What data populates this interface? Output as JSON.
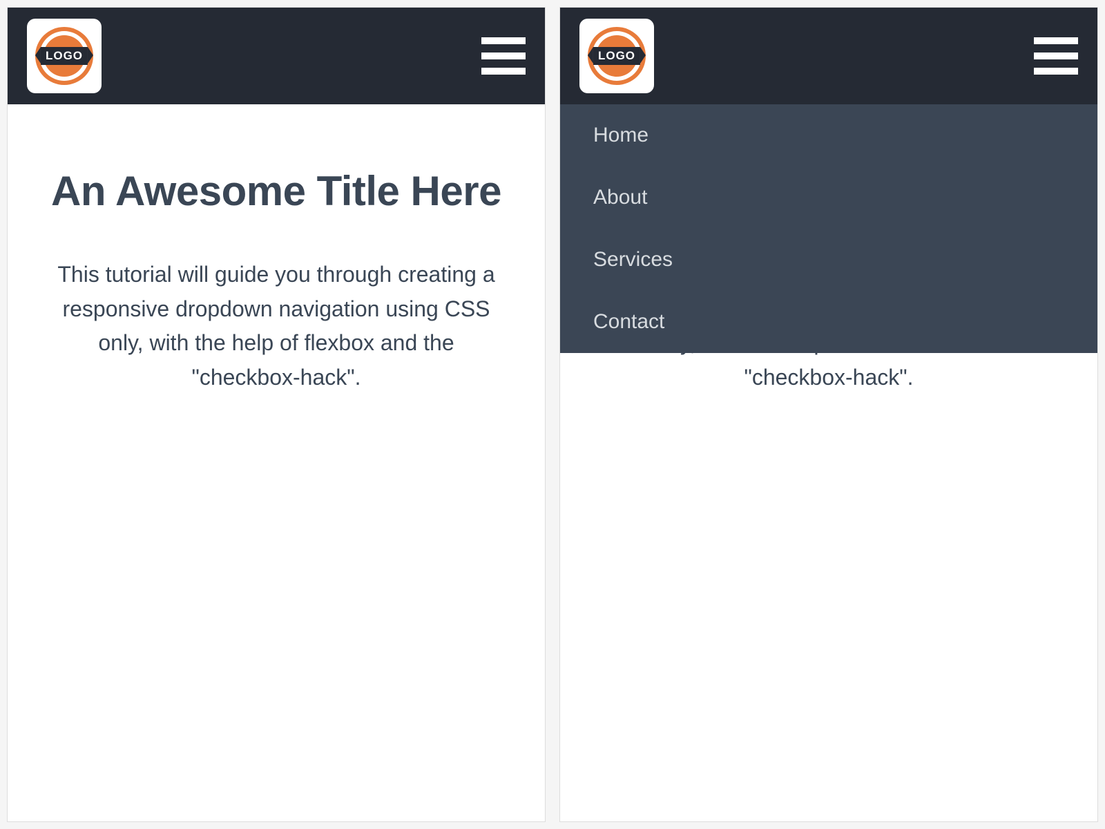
{
  "logo": {
    "text": "LOGO"
  },
  "nav": {
    "items": [
      {
        "label": "Home"
      },
      {
        "label": "About"
      },
      {
        "label": "Services"
      },
      {
        "label": "Contact"
      }
    ]
  },
  "content": {
    "title": "An Awesome Title Here",
    "description": "This tutorial will guide you through creating a responsive dropdown navigation using CSS only, with the help of flexbox and the \"checkbox-hack\"."
  }
}
